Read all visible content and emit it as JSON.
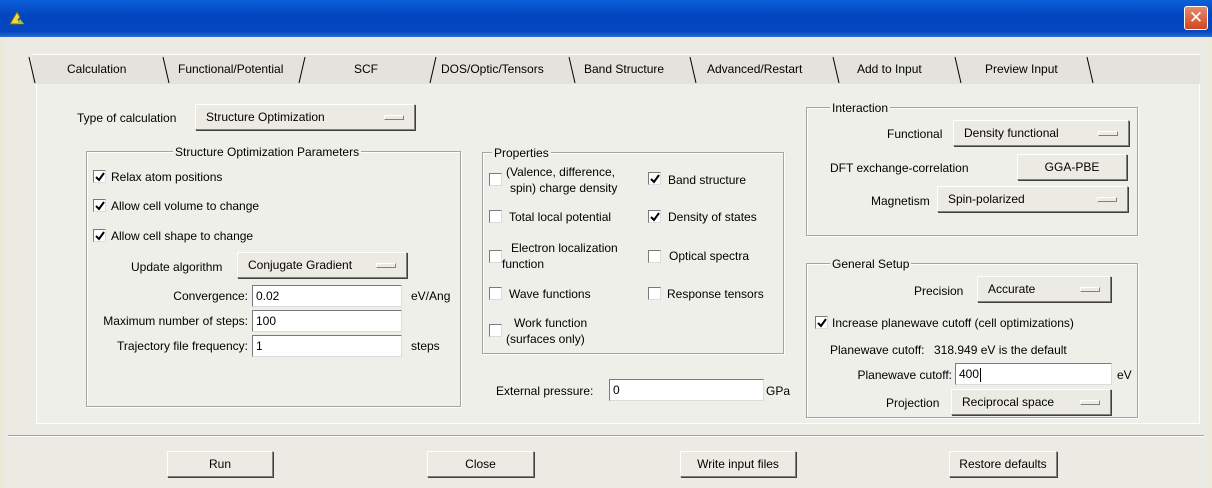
{
  "window": {
    "close_symbol": "✕",
    "icon": "app-logo-icon"
  },
  "tabs": [
    {
      "label": "Calculation"
    },
    {
      "label": "Functional/Potential"
    },
    {
      "label": "SCF"
    },
    {
      "label": "DOS/Optic/Tensors"
    },
    {
      "label": "Band Structure"
    },
    {
      "label": "Advanced/Restart"
    },
    {
      "label": "Add to Input"
    },
    {
      "label": "Preview Input"
    }
  ],
  "calc": {
    "type_label": "Type of calculation",
    "type_value": "Structure Optimization"
  },
  "opt": {
    "title": "Structure Optimization Parameters",
    "relax_atoms": {
      "label": "Relax atom positions",
      "checked": true
    },
    "cell_volume": {
      "label": "Allow cell volume to change",
      "checked": true
    },
    "cell_shape": {
      "label": "Allow cell shape to change",
      "checked": true
    },
    "update_label": "Update algorithm",
    "update_value": "Conjugate Gradient",
    "convergence_label": "Convergence:",
    "convergence_value": "0.02",
    "convergence_unit": "eV/Ang",
    "max_steps_label": "Maximum number of steps:",
    "max_steps_value": "100",
    "traj_label": "Trajectory file frequency:",
    "traj_value": "1",
    "traj_unit": "steps"
  },
  "properties": {
    "title": "Properties",
    "charge_density": {
      "line1": "(Valence, difference,",
      "line2": "spin) charge density",
      "checked": false
    },
    "band_structure": {
      "label": "Band structure",
      "checked": true
    },
    "local_potential": {
      "label": "Total local potential",
      "checked": false
    },
    "dos": {
      "label": "Density of states",
      "checked": true
    },
    "elf": {
      "line1": "Electron localization",
      "line2": "function",
      "checked": false
    },
    "optical": {
      "label": "Optical spectra",
      "checked": false
    },
    "wave": {
      "label": "Wave functions",
      "checked": false
    },
    "response": {
      "label": "Response tensors",
      "checked": false
    },
    "work": {
      "line1": "Work function",
      "line2": "(surfaces only)",
      "checked": false
    }
  },
  "pressure": {
    "label": "External pressure:",
    "value": "0",
    "unit": "GPa"
  },
  "interaction": {
    "title": "Interaction",
    "functional_label": "Functional",
    "functional_value": "Density functional",
    "xc_label": "DFT exchange-correlation",
    "xc_value": "GGA-PBE",
    "magnetism_label": "Magnetism",
    "magnetism_value": "Spin-polarized"
  },
  "general": {
    "title": "General Setup",
    "precision_label": "Precision",
    "precision_value": "Accurate",
    "increase_cutoff": {
      "label": "Increase planewave cutoff (cell optimizations)",
      "checked": true
    },
    "cutoff_default_label": "Planewave cutoff:",
    "cutoff_default_text": "318.949 eV is the default",
    "cutoff_label": "Planewave cutoff:",
    "cutoff_value": "400",
    "cutoff_unit": "eV",
    "projection_label": "Projection",
    "projection_value": "Reciprocal space"
  },
  "buttons": {
    "run": "Run",
    "close": "Close",
    "write": "Write input files",
    "restore": "Restore defaults"
  }
}
